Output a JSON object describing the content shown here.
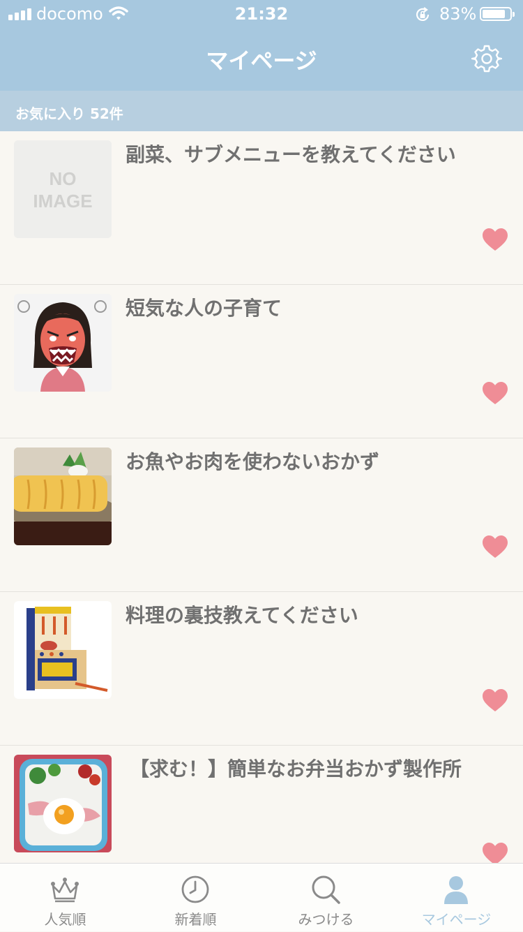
{
  "status_bar": {
    "carrier": "docomo",
    "time": "21:32",
    "battery_pct": "83%",
    "battery_level": 0.83,
    "icons": [
      "signal-icon",
      "wifi-icon",
      "rotation-lock-icon",
      "battery-icon"
    ]
  },
  "nav": {
    "title": "マイページ",
    "settings_icon": "gear-icon"
  },
  "favorites": {
    "label": "お気に入り 52件"
  },
  "items": [
    {
      "title": "副菜、サブメニューを教えてください",
      "thumb": "no-image",
      "favorited": true
    },
    {
      "title": "短気な人の子育て",
      "thumb": "angry-woman-illustration",
      "favorited": true
    },
    {
      "title": "お魚やお肉を使わないおかず",
      "thumb": "tamagoyaki-photo",
      "favorited": true
    },
    {
      "title": "料理の裏技教えてください",
      "thumb": "toy-kitchen-photo",
      "favorited": true
    },
    {
      "title": "【求む！】簡単なお弁当おかず製作所",
      "thumb": "bento-photo",
      "favorited": true
    }
  ],
  "no_image_text": {
    "line1": "NO",
    "line2": "IMAGE"
  },
  "tabs": [
    {
      "label": "人気順",
      "icon": "crown-icon",
      "active": false
    },
    {
      "label": "新着順",
      "icon": "clock-icon",
      "active": false
    },
    {
      "label": "みつける",
      "icon": "search-icon",
      "active": false
    },
    {
      "label": "マイページ",
      "icon": "person-icon",
      "active": true
    }
  ],
  "colors": {
    "header": "#a7c8df",
    "subheader": "#b7cfe0",
    "background": "#f9f7f2",
    "heart": "#ef8d96",
    "title_text": "#707070",
    "active_tab": "#a7c8df",
    "inactive_tab": "#8a8a8a"
  }
}
